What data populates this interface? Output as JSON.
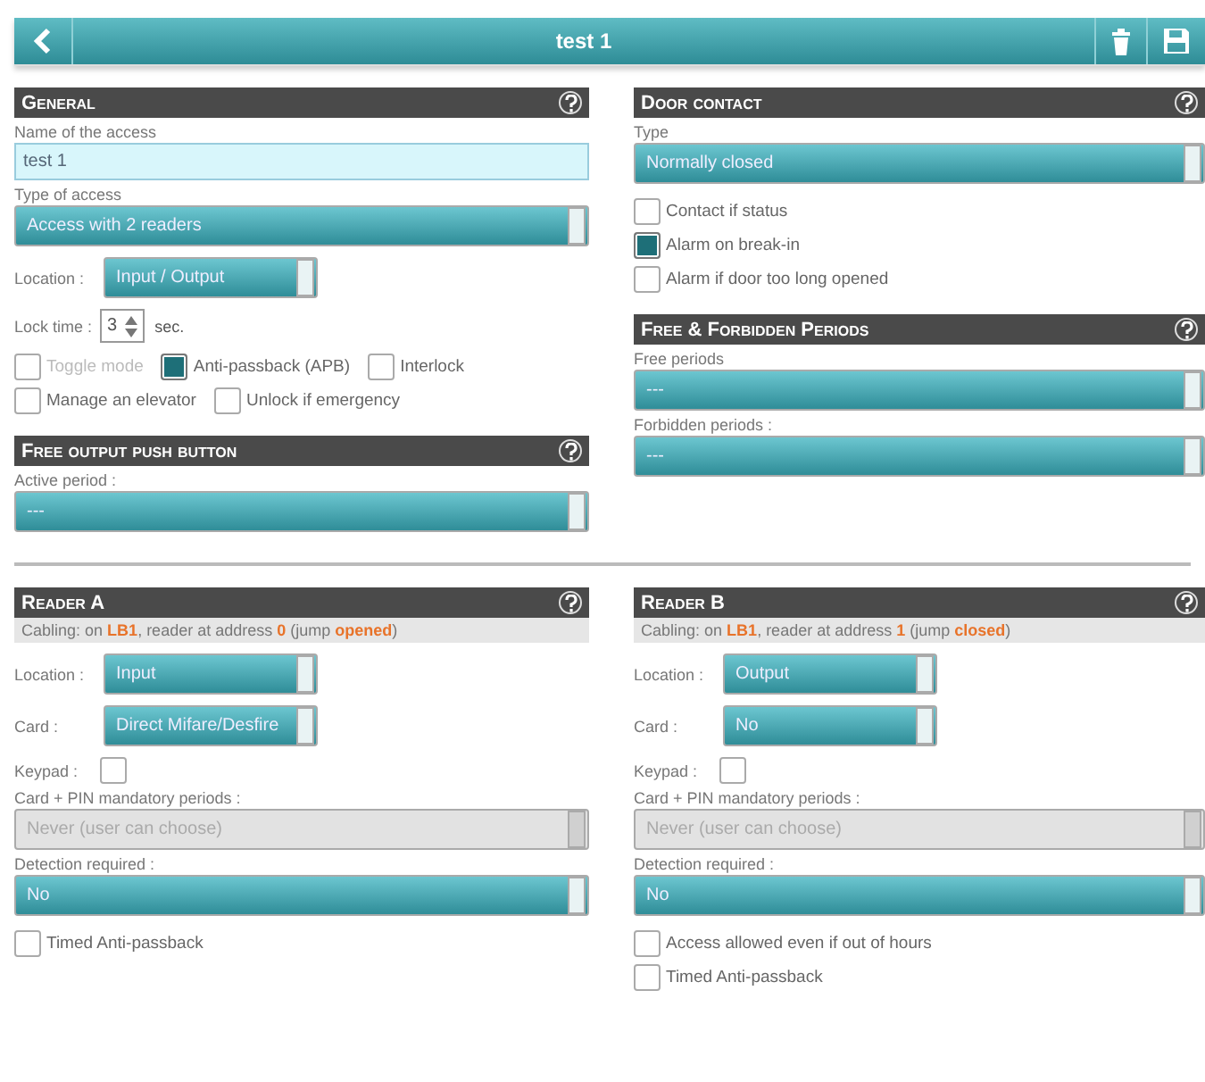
{
  "header": {
    "title": "test 1"
  },
  "top": {
    "left": [
      {
        "title": "General",
        "fields": [
          {
            "kind": "input",
            "label": "Name of the access",
            "value": "test 1"
          },
          {
            "kind": "select",
            "label": "Type of access",
            "value": "Access with 2 readers",
            "disabled": false
          },
          {
            "kind": "inline_select",
            "label": "Location :",
            "value": "Input / Output"
          },
          {
            "kind": "spinner",
            "label": "Lock time :",
            "value": "3",
            "unit": "sec."
          },
          {
            "kind": "checks_row",
            "items": [
              {
                "label": "Toggle mode",
                "checked": false,
                "disabled": true
              },
              {
                "label": "Anti-passback (APB)",
                "checked": true,
                "disabled": false
              },
              {
                "label": "Interlock",
                "checked": false,
                "disabled": false
              },
              {
                "label": "Manage an elevator",
                "checked": false,
                "disabled": false
              },
              {
                "label": "Unlock if emergency",
                "checked": false,
                "disabled": false
              }
            ]
          }
        ]
      },
      {
        "title": "Free output push button",
        "fields": [
          {
            "kind": "select",
            "label": "Active period :",
            "value": "---",
            "disabled": false
          }
        ]
      }
    ],
    "right": [
      {
        "title": "Door contact",
        "fields": [
          {
            "kind": "select",
            "label": "Type",
            "value": "Normally closed",
            "disabled": false
          },
          {
            "kind": "checks_column",
            "items": [
              {
                "label": "Contact if status",
                "checked": false,
                "disabled": false
              },
              {
                "label": "Alarm on break-in",
                "checked": true,
                "disabled": false
              },
              {
                "label": "Alarm if door too long opened",
                "checked": false,
                "disabled": false
              }
            ]
          }
        ]
      },
      {
        "title": "Free & Forbidden Periods",
        "fields": [
          {
            "kind": "select",
            "label": "Free periods",
            "value": "---",
            "disabled": false
          },
          {
            "kind": "select",
            "label": "Forbidden periods :",
            "value": "---",
            "disabled": false
          }
        ]
      }
    ]
  },
  "bottom": {
    "left": [
      {
        "title": "Reader A",
        "fields": [
          {
            "kind": "info",
            "text": "Cabling: on **LB1**, reader at address **0** (jump **opened**)"
          },
          {
            "kind": "inline_select",
            "label": "Location :",
            "value": "Input"
          },
          {
            "kind": "inline_select",
            "label": "Card :",
            "value": "Direct Mifare/Desfire"
          },
          {
            "kind": "keypad",
            "label": "Keypad :",
            "checked": false
          },
          {
            "kind": "select",
            "label": "Card + PIN mandatory periods :",
            "value": "Never (user can choose)",
            "disabled": true
          },
          {
            "kind": "select",
            "label": "Detection required :",
            "value": "No",
            "disabled": false
          },
          {
            "kind": "checks_column",
            "items": [
              {
                "label": "Timed Anti-passback",
                "checked": false,
                "disabled": false
              }
            ]
          }
        ]
      }
    ],
    "right": [
      {
        "title": "Reader B",
        "fields": [
          {
            "kind": "info",
            "text": "Cabling: on **LB1**, reader at address **1** (jump **closed**)"
          },
          {
            "kind": "inline_select",
            "label": "Location :",
            "value": "Output"
          },
          {
            "kind": "inline_select",
            "label": "Card :",
            "value": "No"
          },
          {
            "kind": "keypad",
            "label": "Keypad :",
            "checked": false
          },
          {
            "kind": "select",
            "label": "Card + PIN mandatory periods :",
            "value": "Never (user can choose)",
            "disabled": true
          },
          {
            "kind": "select",
            "label": "Detection required :",
            "value": "No",
            "disabled": false
          },
          {
            "kind": "checks_column",
            "items": [
              {
                "label": "Access allowed even if out of hours",
                "checked": false,
                "disabled": false
              },
              {
                "label": "Timed Anti-passback",
                "checked": false,
                "disabled": false
              }
            ]
          }
        ]
      }
    ]
  }
}
